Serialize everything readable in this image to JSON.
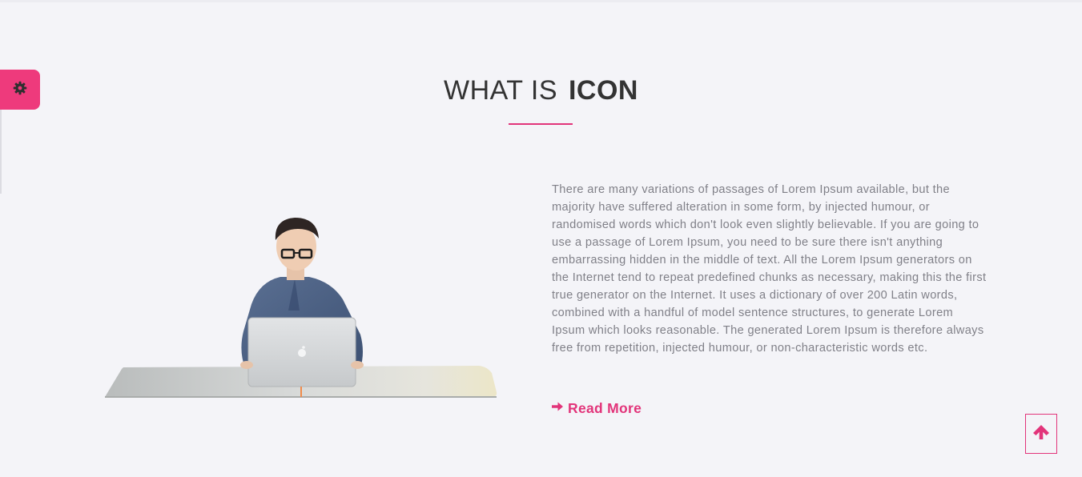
{
  "section": {
    "title_prefix": "WHAT IS",
    "title_highlight": "ICON",
    "description": "There are many variations of passages of Lorem Ipsum available, but the majority have suffered alteration in some form, by injected humour, or randomised words which don't look even slightly believable. If you are going to use a passage of Lorem Ipsum, you need to be sure there isn't anything embarrassing hidden in the middle of text. All the Lorem Ipsum generators on the Internet tend to repeat predefined chunks as necessary, making this the first true generator on the Internet. It uses a dictionary of over 200 Latin words, combined with a handful of model sentence structures, to generate Lorem Ipsum which looks reasonable. The generated Lorem Ipsum is therefore always free from repetition, injected humour, or non-characteristic words etc.",
    "read_more_label": "Read More"
  },
  "icons": {
    "settings": "gear-icon",
    "read_more": "arrow-right-icon",
    "scroll_top": "arrow-up-icon"
  },
  "colors": {
    "accent": "#e2347a",
    "settings_tab": "#ee3a7c",
    "background": "#f4f4f8",
    "title": "#333333",
    "body_text": "#808088"
  }
}
